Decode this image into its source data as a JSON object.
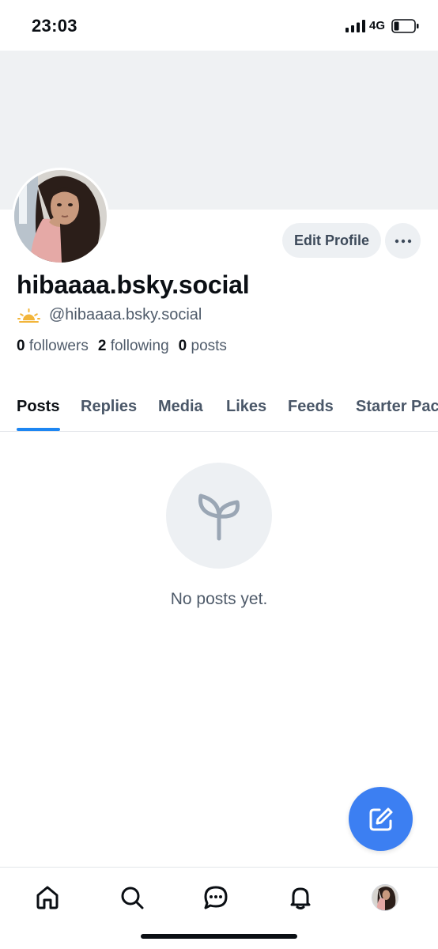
{
  "status_bar": {
    "time": "23:03",
    "network": "4G",
    "icons": [
      "signal-icon",
      "battery-icon"
    ]
  },
  "profile": {
    "display_name": "hibaaaa.bsky.social",
    "handle": "@hibaaaa.bsky.social",
    "badge_icon": "sunrise-icon",
    "edit_button": "Edit Profile",
    "more_icon": "ellipsis-icon",
    "stats": {
      "followers_count": "0",
      "followers_label": "followers",
      "following_count": "2",
      "following_label": "following",
      "posts_count": "0",
      "posts_label": "posts"
    }
  },
  "tabs": [
    "Posts",
    "Replies",
    "Media",
    "Likes",
    "Feeds",
    "Starter Pac"
  ],
  "active_tab": "Posts",
  "empty_state": {
    "icon": "sprout-icon",
    "text": "No posts yet."
  },
  "compose": {
    "icon": "compose-icon"
  },
  "bottom_nav": {
    "items": [
      "home-icon",
      "search-icon",
      "chat-icon",
      "bell-icon",
      "profile-avatar"
    ]
  },
  "colors": {
    "accent": "#1d86f2",
    "fab": "#3c7ff2",
    "banner": "#eff1f3",
    "button_bg": "#edf0f3"
  }
}
